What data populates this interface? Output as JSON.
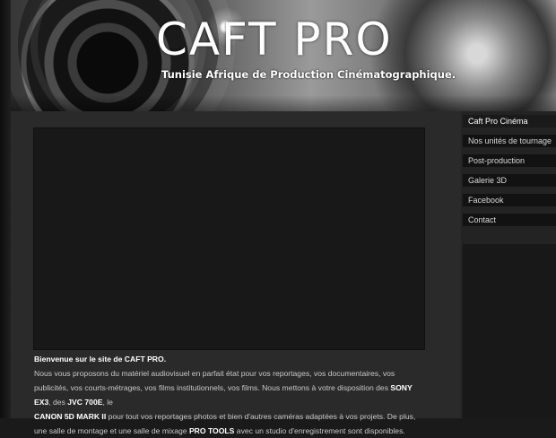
{
  "header": {
    "brand": "CAFT PRO",
    "tagline": "Tunisie Afrique de Production Cinématographique."
  },
  "nav": {
    "items": [
      {
        "label": "Caft Pro Cinéma",
        "active": true
      },
      {
        "label": "Nos unités de tournage",
        "active": false
      },
      {
        "label": "Post-production",
        "active": false
      },
      {
        "label": "Galerie 3D",
        "active": false
      },
      {
        "label": "Facebook",
        "active": false
      },
      {
        "label": "Contact",
        "active": false
      }
    ]
  },
  "content": {
    "welcome_prefix": "Bienvenue sur le site de ",
    "welcome_brand": "CAFT PRO.",
    "p1": "Nous vous proposons du matériel audiovisuel en parfait état pour vos reportages, vos documentaires, vos publicités, vos courts-métrages, vos films institutionnels, vos films. Nous mettons à votre disposition des ",
    "cam1": "SONY EX3",
    "sep1": ", des ",
    "cam2": "JVC 700E",
    "sep2": ", le ",
    "cam3": "CANON 5D MARK II",
    "p2": " pour tout vos reportages photos et bien d'autres caméras adaptées à vos projets. De plus, une salle de montage et une salle de mixage ",
    "tool": "PRO TOOLS",
    "p3": " avec un studio d'enregistrement sont disponibles."
  },
  "colors": {
    "accent": "#6fd3e6",
    "background": "#1a1a1a",
    "content_bg": "#2a2a2a"
  }
}
